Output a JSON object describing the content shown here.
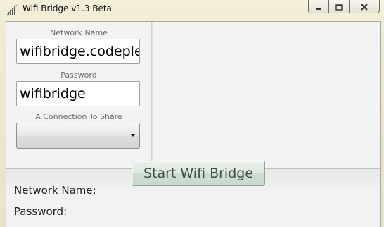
{
  "window": {
    "title": "Wifi Bridge v1.3 Beta",
    "icon": "wifi-signal-icon"
  },
  "caption_buttons": {
    "minimize_icon": "minimize-icon",
    "maximize_icon": "maximize-icon",
    "close_icon": "close-icon"
  },
  "form": {
    "network_name_label": "Network Name",
    "network_name_value": "wifibridge.codeplex",
    "password_label": "Password",
    "password_value": "wifibridge",
    "connection_label": "A Connection To Share",
    "connection_value": ""
  },
  "actions": {
    "start_label": "Start Wifi Bridge"
  },
  "status": {
    "network_name_label": "Network Name:",
    "password_label": "Password:"
  },
  "colors": {
    "start_button_text": "#3c4e46",
    "title_bar": "#f3efd8"
  }
}
